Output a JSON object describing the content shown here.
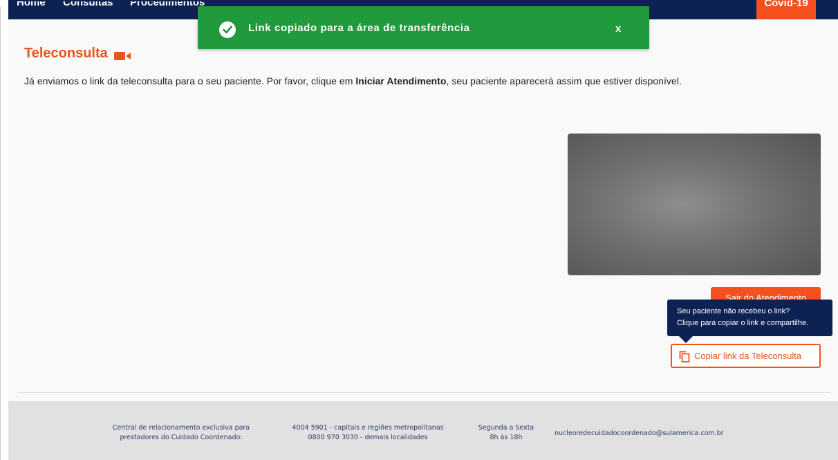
{
  "nav": {
    "items": [
      "Home",
      "Consultas",
      "Procedimentos"
    ],
    "covid_label": "Covid-19"
  },
  "toast": {
    "icon": "check-circle-icon",
    "message": "Link copiado para a área de transferência",
    "close_label": "x",
    "color": "#219a3d"
  },
  "page": {
    "title": "Teleconsulta",
    "title_icon": "video-camera-icon",
    "intro_before": "Já enviamos o link da teleconsulta para o seu paciente. Por favor, clique em ",
    "intro_bold": "Iniciar Atendimento",
    "intro_after": ", seu paciente aparecerá assim que estiver disponível."
  },
  "actions": {
    "exit_label": "Sair do Atendimento",
    "tooltip_line1": "Seu paciente não recebeu o link?",
    "tooltip_line2": "Clique para copiar o link e compartilhe.",
    "copy_label": "Copiar link da Teleconsulta",
    "copy_icon": "copy-icon"
  },
  "footer": {
    "col1_line1": "Central de relacionamento exclusiva para",
    "col1_line2": "prestadores do Cuidado Coordenado:",
    "col2_line1": "4004 5901 - capitais e regiões metropolitanas",
    "col2_line2": "0800 970 3030 - demais localidades",
    "col3_line1": "Segunda a Sexta",
    "col3_line2": "8h às 18h",
    "email": "nucleoredecuidadocoordenado@sulamerica.com.br"
  },
  "colors": {
    "brand_orange": "#f4511e",
    "navy": "#0d2153",
    "success_green": "#219a3d"
  }
}
